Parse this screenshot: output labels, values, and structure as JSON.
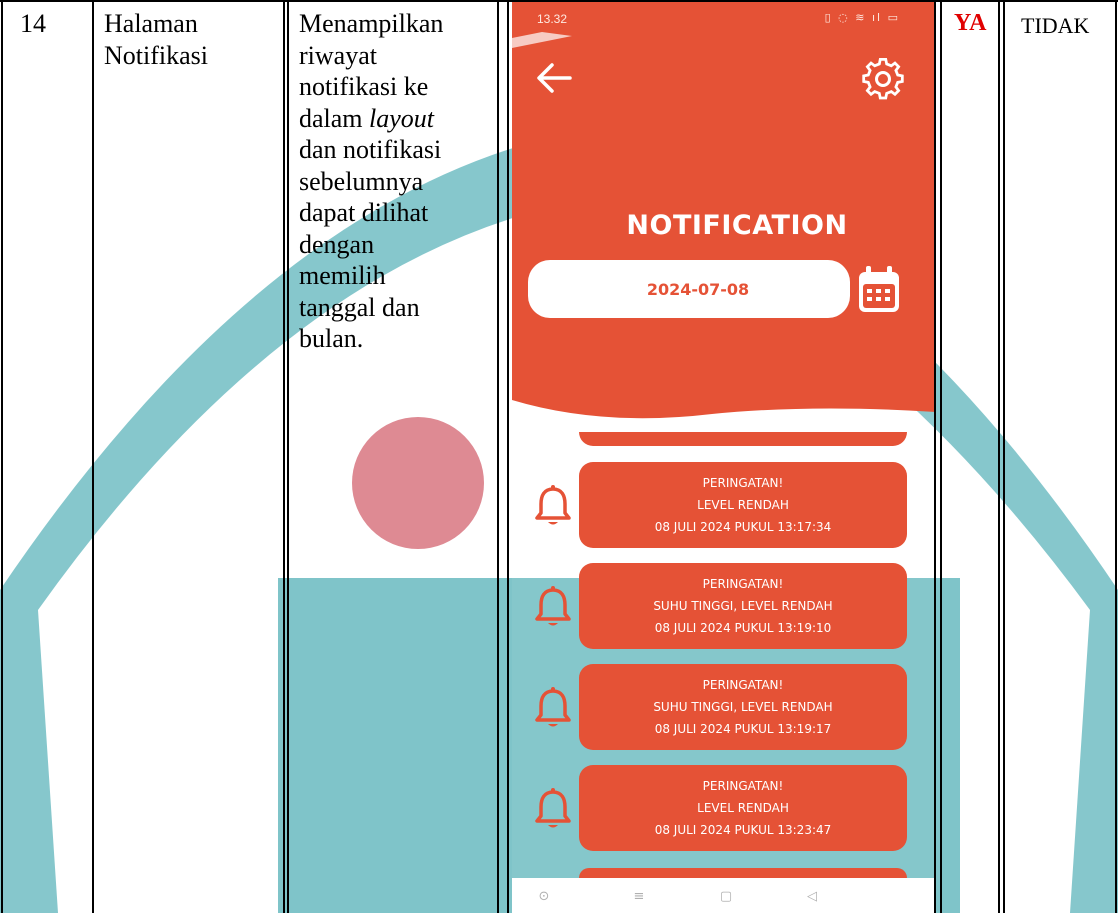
{
  "colors": {
    "accent": "#e55236",
    "teal": "#7fc4c9",
    "pink": "#de8a93",
    "ya": "#e00000"
  },
  "table": {
    "number": "14",
    "page_name_lines": [
      "Halaman",
      "Notifikasi"
    ],
    "description_lines": [
      "Menampilkan",
      "riwayat",
      "notifikasi ke",
      "dalam ",
      "dan notifikasi",
      "sebelumnya",
      "dapat dilihat",
      "dengan",
      "memilih",
      "tanggal dan",
      "bulan."
    ],
    "description_italic": "layout",
    "ya": "YA",
    "tidak": "TIDAK"
  },
  "phone": {
    "status_time": "13.32",
    "status_icons": "▯ ◌ ≋ ıl ▭",
    "title": "NOTIFICATION",
    "date_value": "2024-07-08",
    "icons": {
      "back": "arrow-left-icon",
      "settings": "gear-icon",
      "calendar": "calendar-icon",
      "bell": "bell-icon"
    },
    "notifications": [
      {
        "line1": "PERINGATAN!",
        "line2": "LEVEL RENDAH",
        "line3": "08 JULI 2024 PUKUL 13:17:34"
      },
      {
        "line1": "PERINGATAN!",
        "line2": "SUHU TINGGI, LEVEL RENDAH",
        "line3": "08 JULI 2024 PUKUL 13:19:10"
      },
      {
        "line1": "PERINGATAN!",
        "line2": "SUHU TINGGI, LEVEL RENDAH",
        "line3": "08 JULI 2024 PUKUL 13:19:17"
      },
      {
        "line1": "PERINGATAN!",
        "line2": "LEVEL RENDAH",
        "line3": "08 JULI 2024 PUKUL 13:23:47"
      }
    ],
    "navbar": {
      "home": "⊙",
      "menu": "≡",
      "recent": "▢",
      "back": "◁"
    }
  }
}
